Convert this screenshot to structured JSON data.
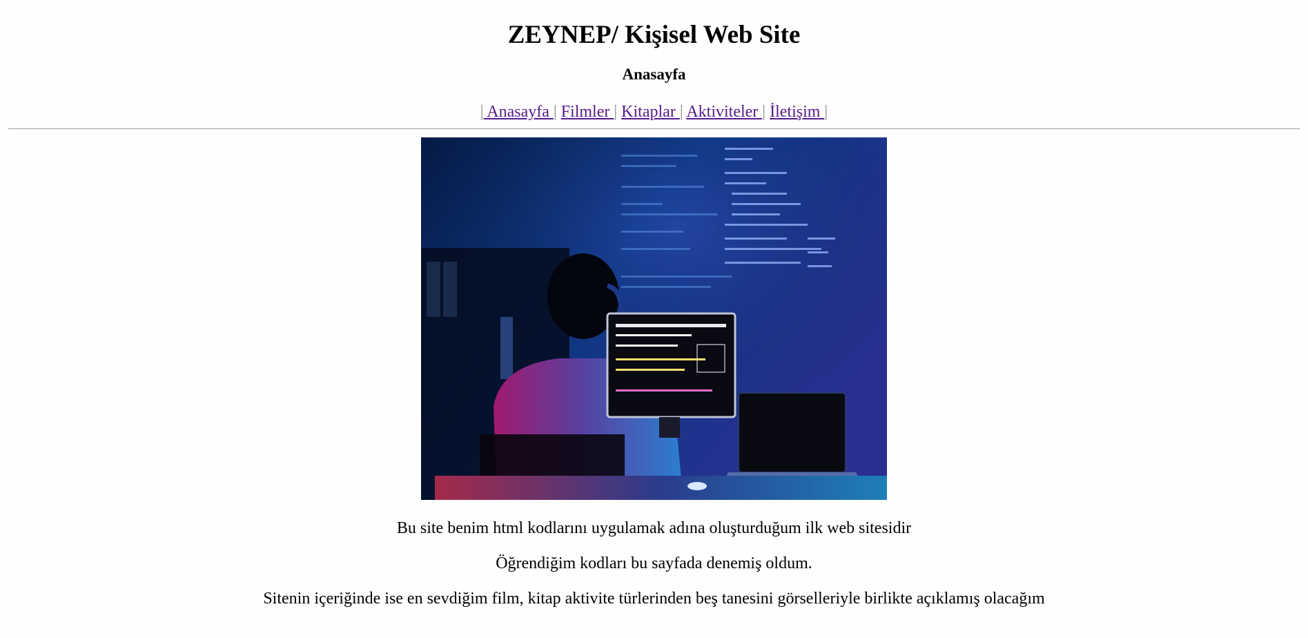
{
  "header": {
    "title": "ZEYNEP/ Kişisel Web Site",
    "subtitle": "Anasayfa"
  },
  "nav": {
    "separator": "|",
    "items": [
      {
        "label": " Anasayfa "
      },
      {
        "label": " Filmler "
      },
      {
        "label": " Kitaplar "
      },
      {
        "label": " Aktiviteler "
      },
      {
        "label": " İletişim "
      }
    ]
  },
  "hero": {
    "icon": "developer-at-computer-photo"
  },
  "content": {
    "paragraphs": [
      "Bu site benim html kodlarını uygulamak adına oluşturduğum ilk web sitesidir",
      "Öğrendiğim kodları bu sayfada denemiş oldum.",
      "Sitenin içeriğinde ise en sevdiğim film, kitap aktivite türlerinden beş tanesini görselleriyle birlikte açıklamış olacağım"
    ]
  },
  "colors": {
    "link": "#551a8b",
    "divider": "#9b9b9b"
  }
}
